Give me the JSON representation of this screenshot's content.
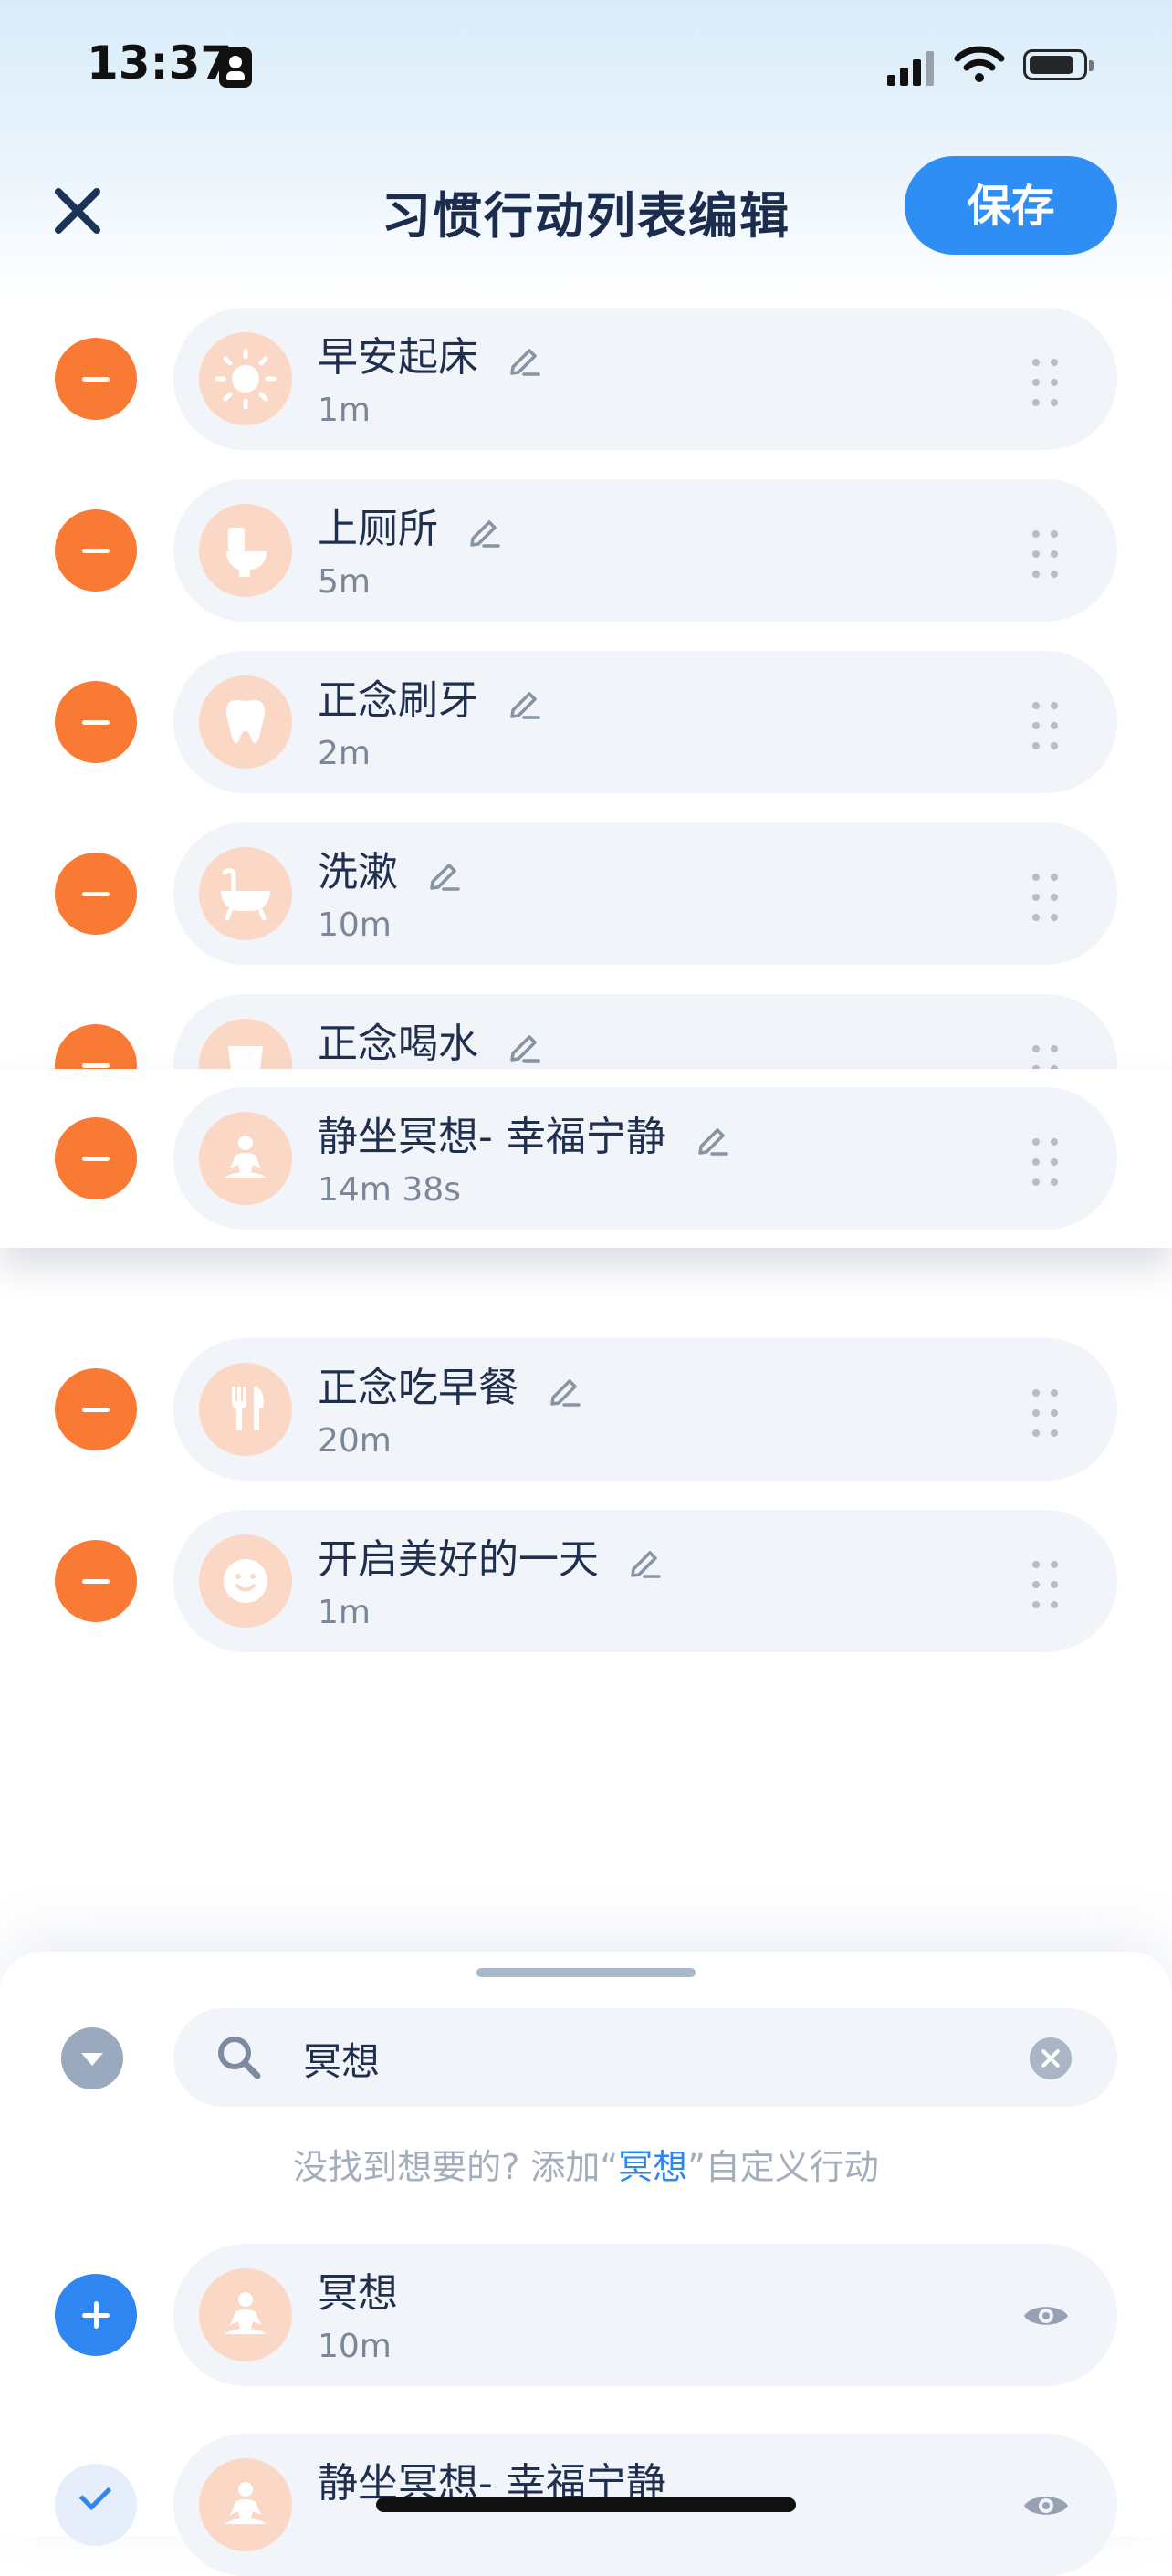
{
  "status_bar": {
    "time": "13:37"
  },
  "header": {
    "title": "习惯行动列表编辑",
    "save_label": "保存"
  },
  "list": [
    {
      "name": "早安起床",
      "duration": "1m",
      "icon": "sun-icon"
    },
    {
      "name": "上厕所",
      "duration": "5m",
      "icon": "toilet-icon"
    },
    {
      "name": "正念刷牙",
      "duration": "2m",
      "icon": "tooth-icon"
    },
    {
      "name": "洗漱",
      "duration": "10m",
      "icon": "bathtub-icon"
    },
    {
      "name": "正念喝水",
      "duration": "",
      "icon": "water-cup-icon"
    },
    {
      "name": "静坐冥想- 幸福宁静",
      "duration": "14m 38s",
      "icon": "meditation-icon",
      "dragging": true
    },
    {
      "name": "正念吃早餐",
      "duration": "20m",
      "icon": "fork-knife-icon"
    },
    {
      "name": "开启美好的一天",
      "duration": "1m",
      "icon": "smile-icon"
    }
  ],
  "search": {
    "value": "冥想"
  },
  "hint": {
    "prefix": "没找到想要的? 添加“",
    "keyword": "冥想",
    "suffix": "”自定义行动"
  },
  "results": [
    {
      "name": "冥想",
      "duration": "10m",
      "icon": "meditation-icon",
      "added": false
    },
    {
      "name": "静坐冥想- 幸福宁静",
      "duration": "",
      "icon": "meditation-icon",
      "added": true
    }
  ],
  "colors": {
    "accent": "#2e8ef3",
    "remove": "#f87a34",
    "icon_bg": "#fbd8c5",
    "card_bg": "#f1f4f9"
  }
}
